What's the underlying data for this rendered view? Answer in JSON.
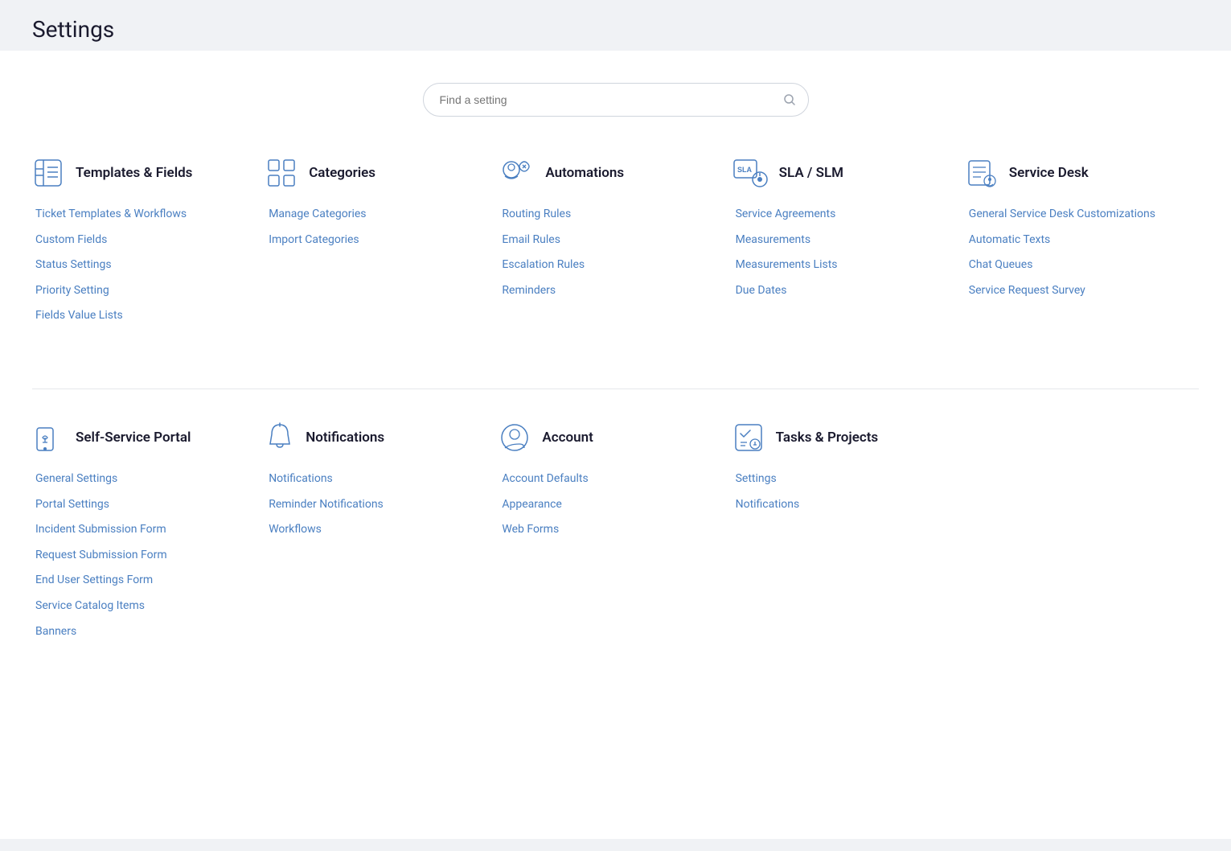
{
  "page": {
    "title": "Settings"
  },
  "search": {
    "placeholder": "Find a setting"
  },
  "sections_row1": [
    {
      "id": "templates-fields",
      "icon": "templates",
      "title": "Templates & Fields",
      "links": [
        "Ticket Templates & Workflows",
        "Custom Fields",
        "Status Settings",
        "Priority Setting",
        "Fields Value Lists"
      ]
    },
    {
      "id": "categories",
      "icon": "categories",
      "title": "Categories",
      "links": [
        "Manage Categories",
        "Import Categories"
      ]
    },
    {
      "id": "automations",
      "icon": "automations",
      "title": "Automations",
      "links": [
        "Routing Rules",
        "Email Rules",
        "Escalation Rules",
        "Reminders"
      ]
    },
    {
      "id": "sla-slm",
      "icon": "sla",
      "title": "SLA / SLM",
      "links": [
        "Service Agreements",
        "Measurements",
        "Measurements Lists",
        "Due Dates"
      ]
    },
    {
      "id": "service-desk",
      "icon": "servicedesk",
      "title": "Service Desk",
      "links": [
        "General Service Desk Customizations",
        "Automatic Texts",
        "Chat Queues",
        "Service Request Survey"
      ]
    }
  ],
  "sections_row2": [
    {
      "id": "self-service-portal",
      "icon": "portal",
      "title": "Self-Service Portal",
      "links": [
        "General Settings",
        "Portal Settings",
        "Incident Submission Form",
        "Request Submission Form",
        "End User Settings Form",
        "Service Catalog Items",
        "Banners"
      ]
    },
    {
      "id": "notifications",
      "icon": "bell",
      "title": "Notifications",
      "links": [
        "Notifications",
        "Reminder Notifications",
        "Workflows"
      ]
    },
    {
      "id": "account",
      "icon": "account",
      "title": "Account",
      "links": [
        "Account Defaults",
        "Appearance",
        "Web Forms"
      ]
    },
    {
      "id": "tasks-projects",
      "icon": "tasks",
      "title": "Tasks & Projects",
      "links": [
        "Settings",
        "Notifications"
      ]
    },
    {
      "id": "empty",
      "icon": "",
      "title": "",
      "links": []
    }
  ]
}
